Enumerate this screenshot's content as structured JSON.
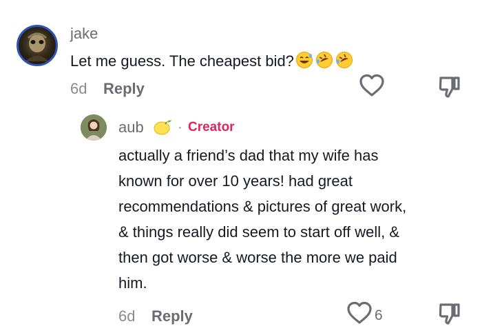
{
  "comment": {
    "username": "jake",
    "text": "Let me guess. The cheapest bid?",
    "emojis": [
      "grinning-sweat-emoji",
      "rofl-emoji",
      "rofl-emoji"
    ],
    "time": "6d",
    "reply_label": "Reply"
  },
  "reply": {
    "username": "aub",
    "badge_icon": "lemon-emoji",
    "separator": "·",
    "creator_label": "Creator",
    "text_lines": [
      "actually a friend’s dad that my wife has",
      "known for over 10 years! had great",
      "recommendations & pictures of great work,",
      "& things really did seem to start off well, &",
      "then got worse & worse the more we paid",
      "him."
    ],
    "time": "6d",
    "reply_label": "Reply",
    "like_count": "6"
  },
  "colors": {
    "creator": "#e0245e",
    "icon_gray": "#6b6b73"
  }
}
